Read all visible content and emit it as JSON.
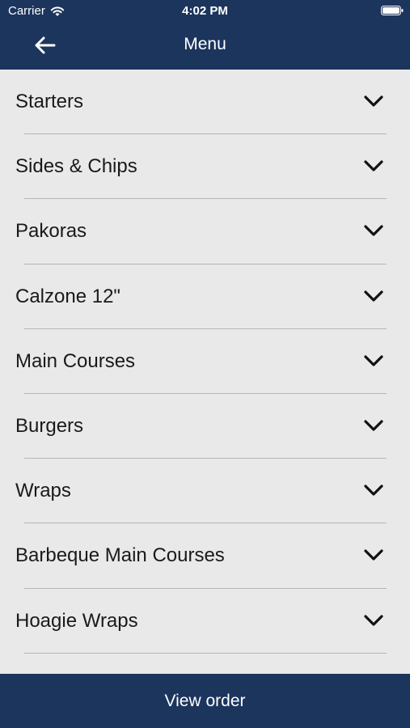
{
  "status_bar": {
    "carrier": "Carrier",
    "time": "4:02 PM",
    "icons": [
      "wifi-icon",
      "battery-icon"
    ]
  },
  "header": {
    "title": "Menu",
    "back_icon": "arrow-left-icon",
    "background": "#1c355d"
  },
  "menu": {
    "items": [
      {
        "label": "Starters"
      },
      {
        "label": "Sides & Chips"
      },
      {
        "label": "Pakoras"
      },
      {
        "label": "Calzone 12\""
      },
      {
        "label": "Main Courses"
      },
      {
        "label": "Burgers"
      },
      {
        "label": "Wraps"
      },
      {
        "label": "Barbeque Main Courses"
      },
      {
        "label": "Hoagie Wraps"
      }
    ],
    "expand_icon": "chevron-down-icon"
  },
  "footer": {
    "view_order_label": "View order",
    "background": "#1c355d"
  }
}
